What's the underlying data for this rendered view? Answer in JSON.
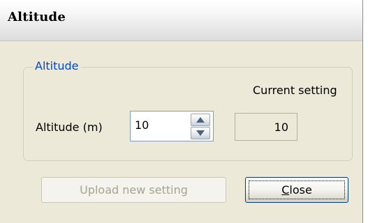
{
  "window": {
    "title": "Altitude"
  },
  "group": {
    "legend": "Altitude",
    "current_setting_label": "Current setting",
    "altitude_label": "Altitude (m)",
    "altitude_input_value": "10",
    "current_setting_value": "10"
  },
  "buttons": {
    "upload_label": "Upload new setting",
    "close_label_mnemonic": "C",
    "close_label_rest": "lose"
  },
  "icons": {
    "spin_up": "arrow-up-icon",
    "spin_down": "arrow-down-icon"
  },
  "colors": {
    "legend": "#0046d5",
    "dialog_bg": "#ece9d8",
    "disabled_text": "#a5a392"
  }
}
